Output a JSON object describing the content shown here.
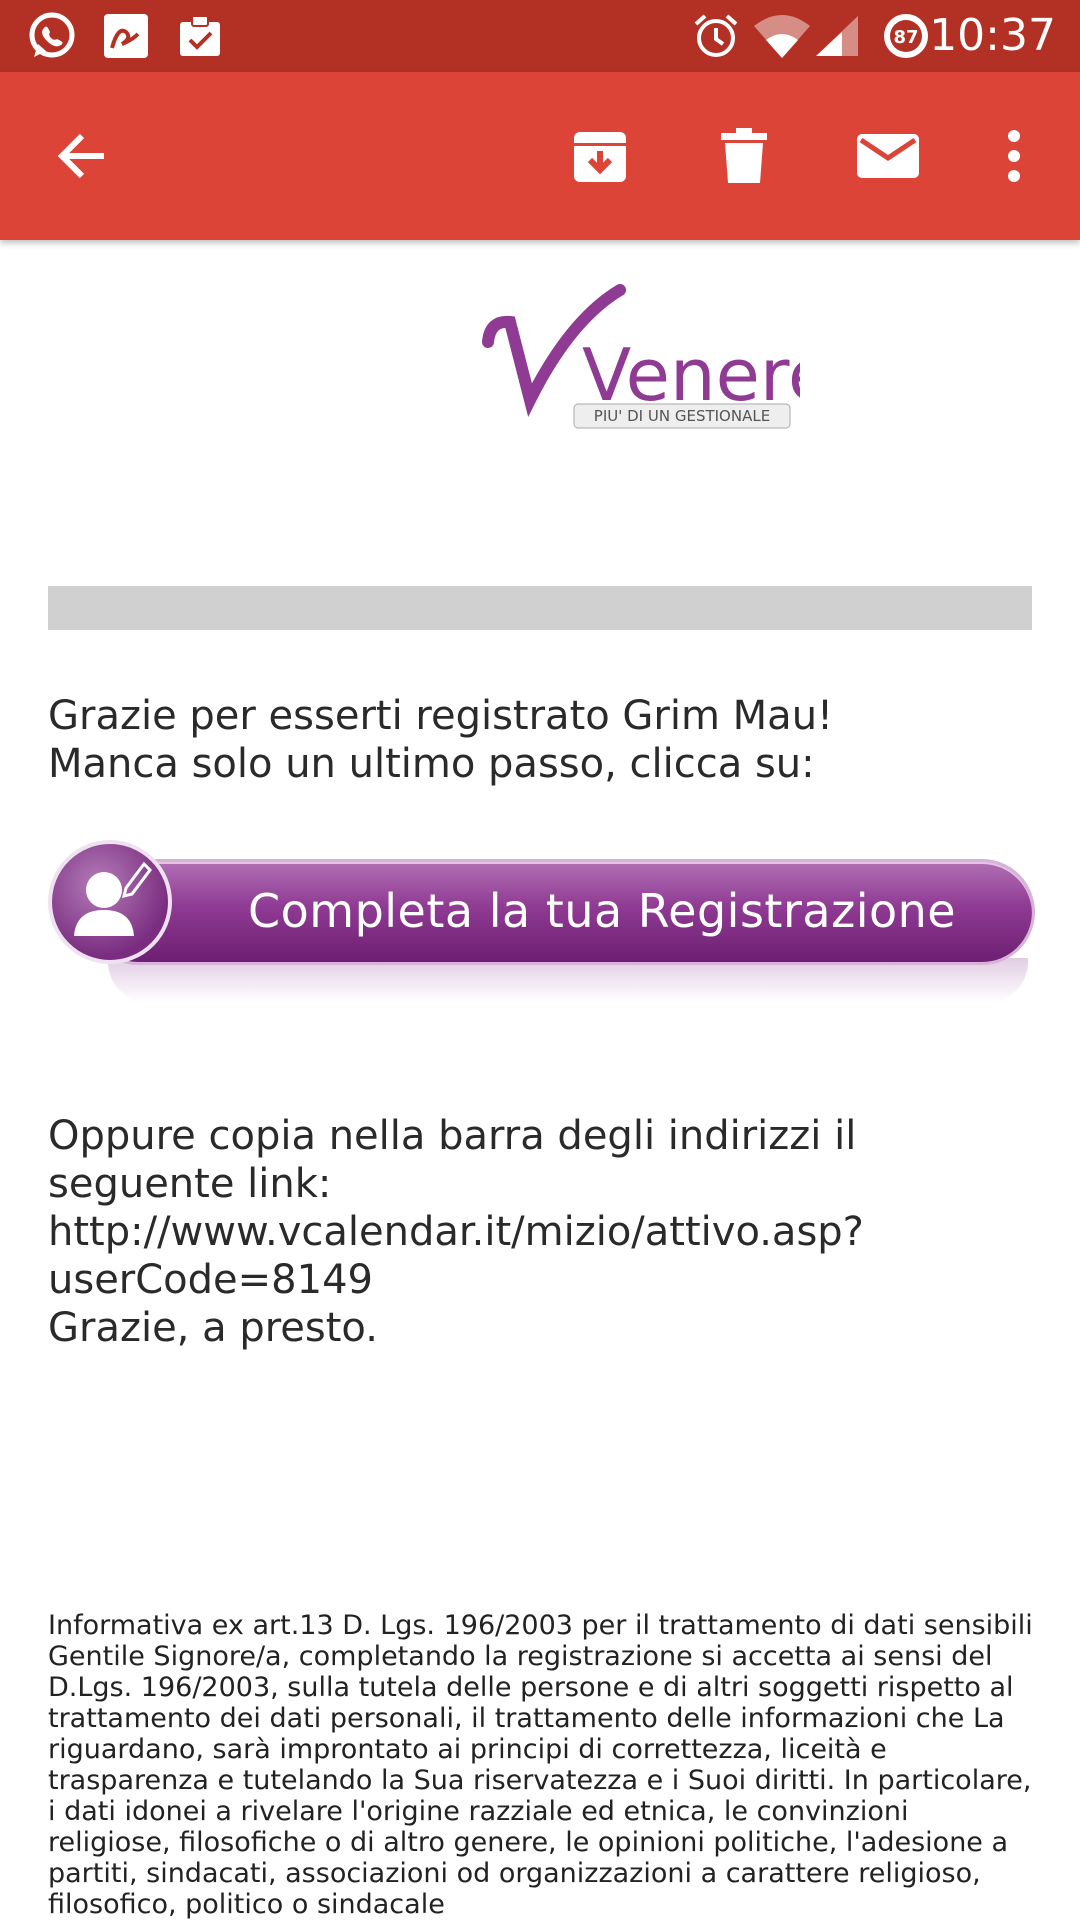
{
  "status_bar": {
    "time": "10:37",
    "battery_level": "87",
    "icons_left": [
      "whatsapp-icon",
      "signature-icon",
      "clipboard-check-icon"
    ],
    "icons_right": [
      "alarm-icon",
      "wifi-icon",
      "signal-icon",
      "battery-icon"
    ]
  },
  "toolbar": {
    "icons": [
      "back-arrow-icon",
      "archive-icon",
      "trash-icon",
      "mail-icon",
      "more-vert-icon"
    ]
  },
  "email": {
    "logo": {
      "brand": "Venere",
      "tagline": "PIU' DI UN GESTIONALE"
    },
    "greeting": "Grazie per esserti registrato Grim Mau!\nManca solo un ultimo passo, clicca su:",
    "cta_label": "Completa la tua Registrazione",
    "alt_instructions": "Oppure copia nella barra degli indirizzi il\nseguente link:",
    "link": "http://www.vcalendar.it/mizio/attivo.asp?\nuserCode=8149",
    "closing": "Grazie, a presto.",
    "privacy_notice": "Informativa ex art.13 D. Lgs. 196/2003 per il trattamento di dati sensibili Gentile Signore/a, completando la registrazione si accetta ai sensi del D.Lgs. 196/2003, sulla tutela delle persone e di altri soggetti rispetto al trattamento dei dati personali, il trattamento delle informazioni che La riguardano, sarà improntato ai principi di correttezza, liceità e trasparenza e tutelando la Sua riservatezza e i Suoi diritti. In particolare, i dati idonei a rivelare l'origine razziale ed etnica, le convinzioni religiose, filosofiche o di altro genere, le opinioni politiche, l'adesione a partiti, sindacati, associazioni od organizzazioni a carattere religioso, filosofico, politico o sindacale"
  },
  "colors": {
    "status_bar": "#b33124",
    "app_bar": "#db4437",
    "brand_purple": "#8f3a93"
  }
}
